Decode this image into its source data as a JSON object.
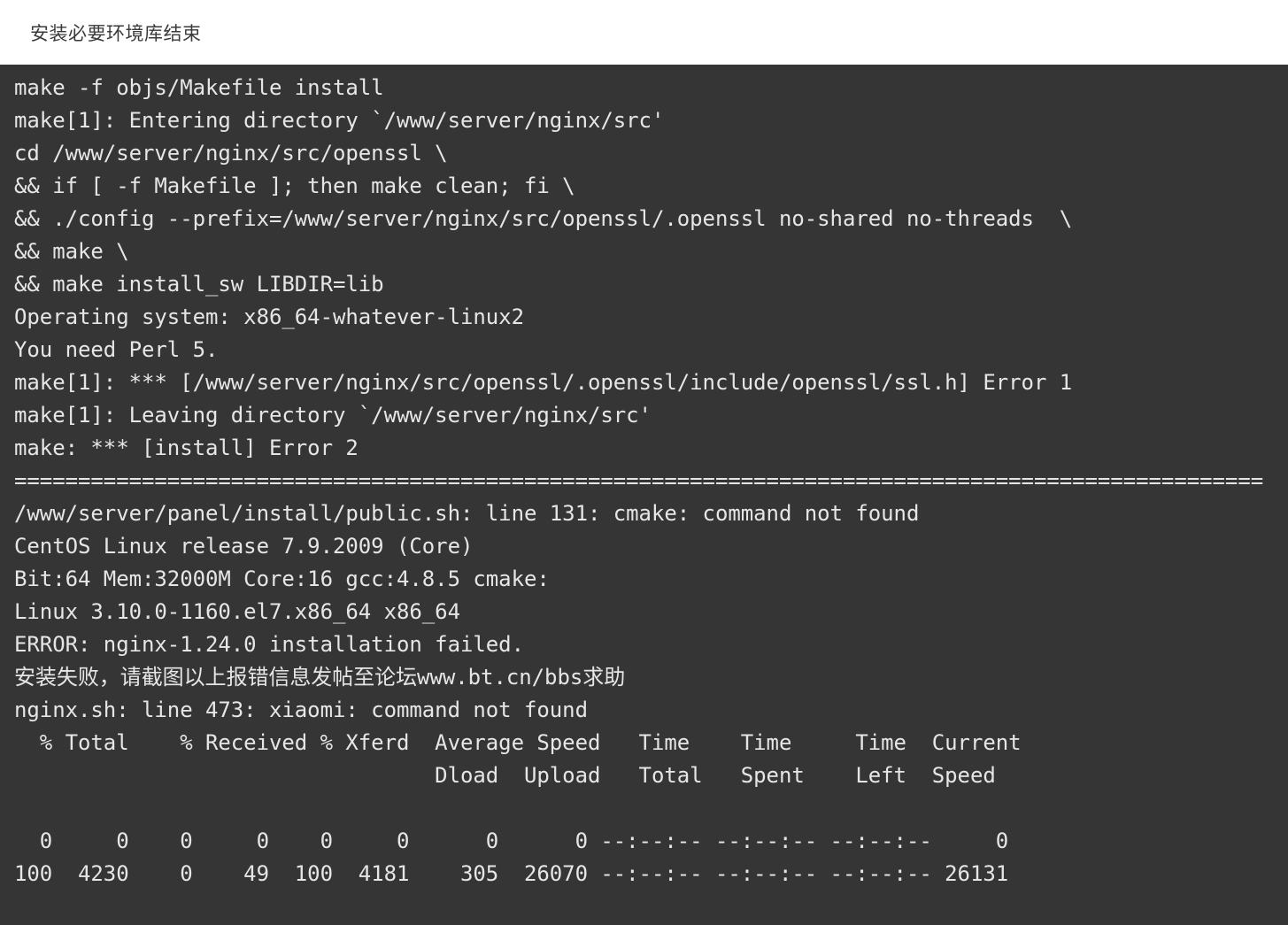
{
  "header": {
    "title": "安装必要环境库结束"
  },
  "colors": {
    "page_background": "#ffffff",
    "terminal_background": "#353535",
    "terminal_text": "#e6e6e6",
    "header_text": "#3a3a3a"
  },
  "terminal": {
    "lines": [
      "make -f objs/Makefile install",
      "make[1]: Entering directory `/www/server/nginx/src'",
      "cd /www/server/nginx/src/openssl \\",
      "&& if [ -f Makefile ]; then make clean; fi \\",
      "&& ./config --prefix=/www/server/nginx/src/openssl/.openssl no-shared no-threads  \\",
      "&& make \\",
      "&& make install_sw LIBDIR=lib",
      "Operating system: x86_64-whatever-linux2",
      "You need Perl 5.",
      "make[1]: *** [/www/server/nginx/src/openssl/.openssl/include/openssl/ssl.h] Error 1",
      "make[1]: Leaving directory `/www/server/nginx/src'",
      "make: *** [install] Error 2",
      "==================================================================================================",
      "/www/server/panel/install/public.sh: line 131: cmake: command not found",
      "CentOS Linux release 7.9.2009 (Core)",
      "Bit:64 Mem:32000M Core:16 gcc:4.8.5 cmake:",
      "Linux 3.10.0-1160.el7.x86_64 x86_64",
      "ERROR: nginx-1.24.0 installation failed.",
      "安装失败，请截图以上报错信息发帖至论坛www.bt.cn/bbs求助",
      "nginx.sh: line 473: xiaomi: command not found",
      "  % Total    % Received % Xferd  Average Speed   Time    Time     Time  Current",
      "                                 Dload  Upload   Total   Spent    Left  Speed",
      "",
      "  0     0    0     0    0     0      0      0 --:--:-- --:--:-- --:--:--     0",
      "100  4230    0    49  100  4181    305  26070 --:--:-- --:--:-- --:--:-- 26131"
    ],
    "wrapped_line_indices": [
      12
    ],
    "cjk_line_indices": [
      18
    ],
    "curl_progress": {
      "headers_row1": [
        "% Total",
        "% Received",
        "% Xferd",
        "Average Speed",
        "Time",
        "Time",
        "Time",
        "Current"
      ],
      "headers_row2": [
        "Dload",
        "Upload",
        "Total",
        "Spent",
        "Left",
        "Speed"
      ],
      "rows": [
        [
          "0",
          "0",
          "0",
          "0",
          "0",
          "0",
          "0",
          "0",
          "--:--:--",
          "--:--:--",
          "--:--:--",
          "0"
        ],
        [
          "100",
          "4230",
          "0",
          "49",
          "100",
          "4181",
          "305",
          "26070",
          "--:--:--",
          "--:--:--",
          "--:--:--",
          "26131"
        ]
      ]
    }
  }
}
